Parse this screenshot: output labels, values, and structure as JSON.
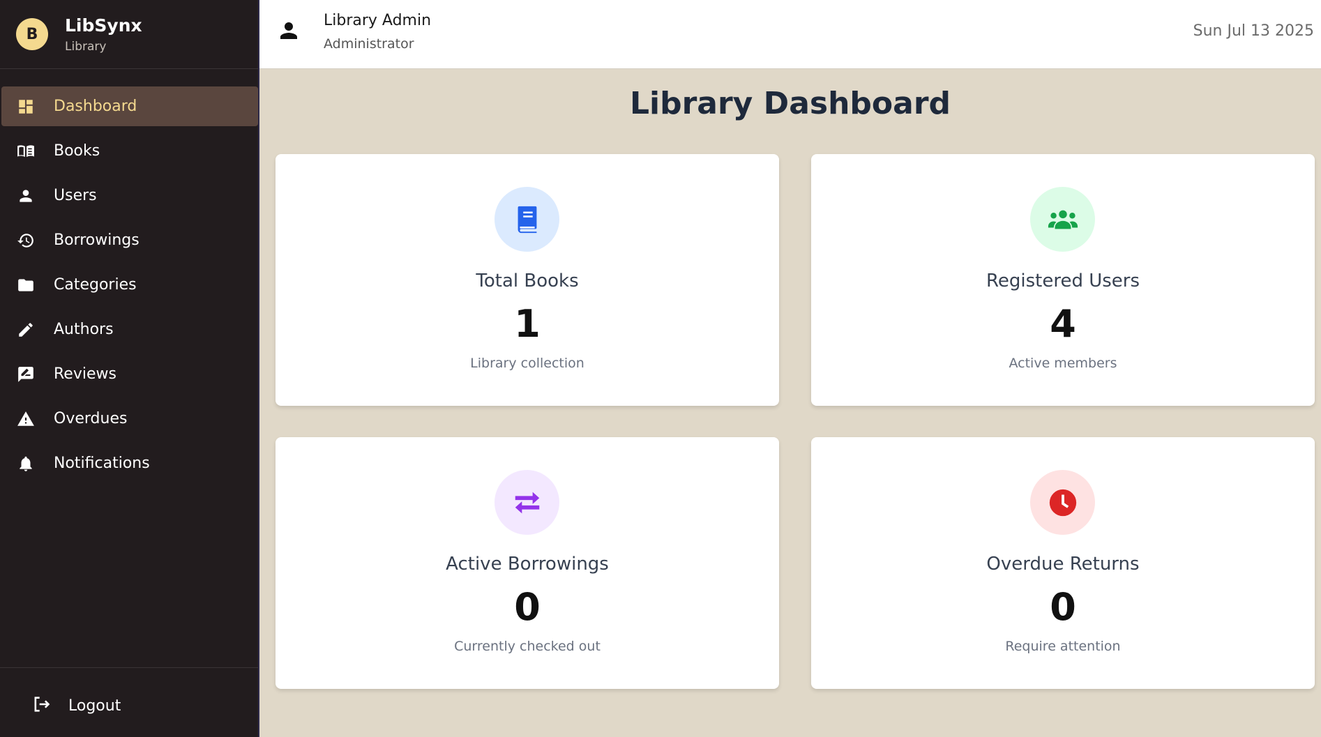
{
  "brand": {
    "initial": "B",
    "name": "LibSynx",
    "subtitle": "Library"
  },
  "sidebar": {
    "items": [
      {
        "label": "Dashboard",
        "icon": "dashboard-icon",
        "active": true
      },
      {
        "label": "Books",
        "icon": "book-open-icon"
      },
      {
        "label": "Users",
        "icon": "user-icon"
      },
      {
        "label": "Borrowings",
        "icon": "history-icon"
      },
      {
        "label": "Categories",
        "icon": "folder-icon"
      },
      {
        "label": "Authors",
        "icon": "pencil-icon"
      },
      {
        "label": "Reviews",
        "icon": "review-icon"
      },
      {
        "label": "Overdues",
        "icon": "warning-icon"
      },
      {
        "label": "Notifications",
        "icon": "bell-icon"
      }
    ],
    "logout_label": "Logout"
  },
  "header": {
    "user_name": "Library Admin",
    "user_role": "Administrator",
    "date": "Sun Jul 13 2025"
  },
  "main": {
    "title": "Library Dashboard",
    "cards": [
      {
        "title": "Total Books",
        "value": "1",
        "subtitle": "Library collection",
        "icon": "book-icon",
        "icon_color": "#2563eb",
        "icon_bg": "#dbeafe"
      },
      {
        "title": "Registered Users",
        "value": "4",
        "subtitle": "Active members",
        "icon": "users-icon",
        "icon_color": "#16a34a",
        "icon_bg": "#dcfce7"
      },
      {
        "title": "Active Borrowings",
        "value": "0",
        "subtitle": "Currently checked out",
        "icon": "exchange-icon",
        "icon_color": "#9333ea",
        "icon_bg": "#f3e8ff"
      },
      {
        "title": "Overdue Returns",
        "value": "0",
        "subtitle": "Require attention",
        "icon": "clock-icon",
        "icon_color": "#dc2626",
        "icon_bg": "#fee2e2"
      }
    ]
  },
  "colors": {
    "sidebar_bg": "#221c1e",
    "accent": "#f4d98f",
    "active_bg": "#5a463e",
    "page_bg": "#e0d8c8"
  }
}
